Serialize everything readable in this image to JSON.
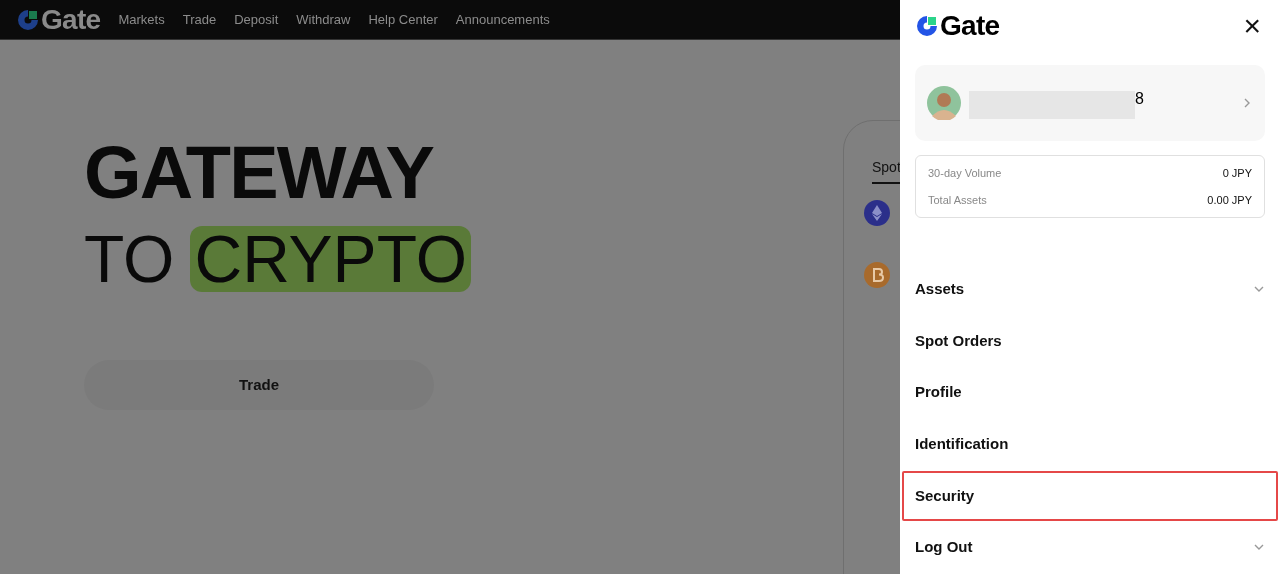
{
  "navbar": {
    "logo": "Gate",
    "links": [
      "Markets",
      "Trade",
      "Deposit",
      "Withdraw",
      "Help Center",
      "Announcements"
    ]
  },
  "hero": {
    "line_1": "GATEWAY",
    "line_2_plain": "TO",
    "line_2_highlight": "CRYPTO",
    "button": "Trade"
  },
  "market_card": {
    "tab": "Spot",
    "rows": [
      {
        "kind": "eth"
      },
      {
        "kind": "btc"
      }
    ]
  },
  "drawer": {
    "logo": "Gate",
    "close": "×",
    "account": {
      "name_tail": "8"
    },
    "stats": [
      {
        "label": "30-day Volume",
        "value": "0 JPY"
      },
      {
        "label": "Total Assets",
        "value": "0.00 JPY"
      }
    ],
    "menu": [
      {
        "label": "Assets",
        "kind": "dropdown",
        "highlighted": false
      },
      {
        "label": "Spot Orders",
        "kind": "link",
        "highlighted": false
      },
      {
        "label": "Profile",
        "kind": "link",
        "highlighted": false
      },
      {
        "label": "Identification",
        "kind": "link",
        "highlighted": false
      },
      {
        "label": "Security",
        "kind": "link",
        "highlighted": true
      },
      {
        "label": "Log Out",
        "kind": "dropdown",
        "highlighted": false
      }
    ]
  }
}
